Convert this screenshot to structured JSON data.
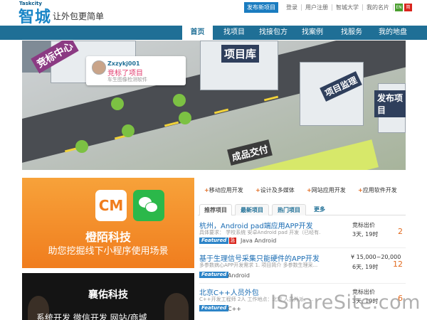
{
  "header": {
    "logo_small": "Taskcity",
    "logo_big": "智城",
    "slogan": "让外包更简单",
    "publish_button": "发布新项目",
    "links": [
      "登录",
      "用户注册",
      "智城大学",
      "我的名片"
    ],
    "lang_en": "EN",
    "lang_cn": "简"
  },
  "nav": {
    "items": [
      "首页",
      "找项目",
      "找接包方",
      "找案例",
      "找服务",
      "我的地盘"
    ],
    "active_index": 0
  },
  "banner": {
    "signs": [
      "竞标中心",
      "项目库",
      "项目监理",
      "成品交付",
      "发布项目"
    ],
    "popup": {
      "user": "Zxzykj001",
      "action": "竞标了项目",
      "project": "车生图像检测软件"
    }
  },
  "promo1": {
    "logo_text": "CM",
    "title": "橙陌科技",
    "subtitle": "助您挖掘线下小程序使用场景"
  },
  "promo2": {
    "title": "襄佑科技",
    "subtitle": "系统开发  微信开发  网站/商城"
  },
  "categories": [
    "移动应用开发",
    "设计及多媒体",
    "网站应用开发",
    "应用软件开发"
  ],
  "tabs": [
    "推荐项目",
    "最新项目",
    "热门项目",
    "更多"
  ],
  "projects": [
    {
      "title": "杭州，Android pad端应用APP开发",
      "desc": "具体要求： 学校系统 安卓Android pad 开发（已经有...",
      "featured": "Featured",
      "badge": "急",
      "tag": "Java Android",
      "price_label": "竞标出价",
      "time": "3天, 19时",
      "count": "2"
    },
    {
      "title": "基于生理信号采集只能硬件的APP开发",
      "desc": "多参数病心APP开发需求 1. 项目简介 多参数生理采...",
      "featured": "Featured",
      "badge": "",
      "tag": "Android",
      "price_label": "¥ 15,000~20,000",
      "time": "6天, 19时",
      "count": "12"
    },
    {
      "title": "北京C++人员外包",
      "desc": "C++开发工程师 2人 工作地点：北京 人员外派、...",
      "featured": "Featured",
      "badge": "",
      "tag": "C++",
      "price_label": "竞标出价",
      "time": "3天, 19时",
      "count": "6"
    }
  ],
  "watermark": "IShareSite.com"
}
